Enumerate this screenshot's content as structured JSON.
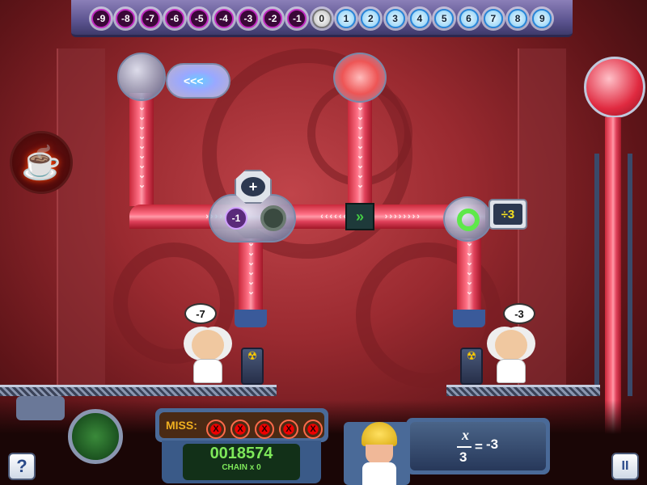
{
  "number_line": [
    "-9",
    "-8",
    "-7",
    "-6",
    "-5",
    "-4",
    "-3",
    "-2",
    "-1",
    "0",
    "1",
    "2",
    "3",
    "4",
    "5",
    "6",
    "7",
    "8",
    "9"
  ],
  "machines": {
    "adder_symbol": "+",
    "adder_token": "-1",
    "divider_label": "÷3",
    "capsule_arrows": "<<<"
  },
  "scientists": [
    {
      "bubble": "-7"
    },
    {
      "bubble": "-3"
    }
  ],
  "hud": {
    "miss_label": "MISS:",
    "miss_marks": [
      "X",
      "X",
      "X",
      "X",
      "X"
    ],
    "score": "0018574",
    "chain": "CHAIN x 0",
    "equation": {
      "numerator": "x",
      "denominator": "3",
      "equals": "=",
      "rhs": "-3"
    },
    "help_label": "?",
    "pause_label": "II"
  },
  "colors": {
    "pipe": "#e8405a",
    "score_text": "#7ee85a",
    "miss_text": "#f0b020",
    "divider_text": "#f5e020"
  }
}
